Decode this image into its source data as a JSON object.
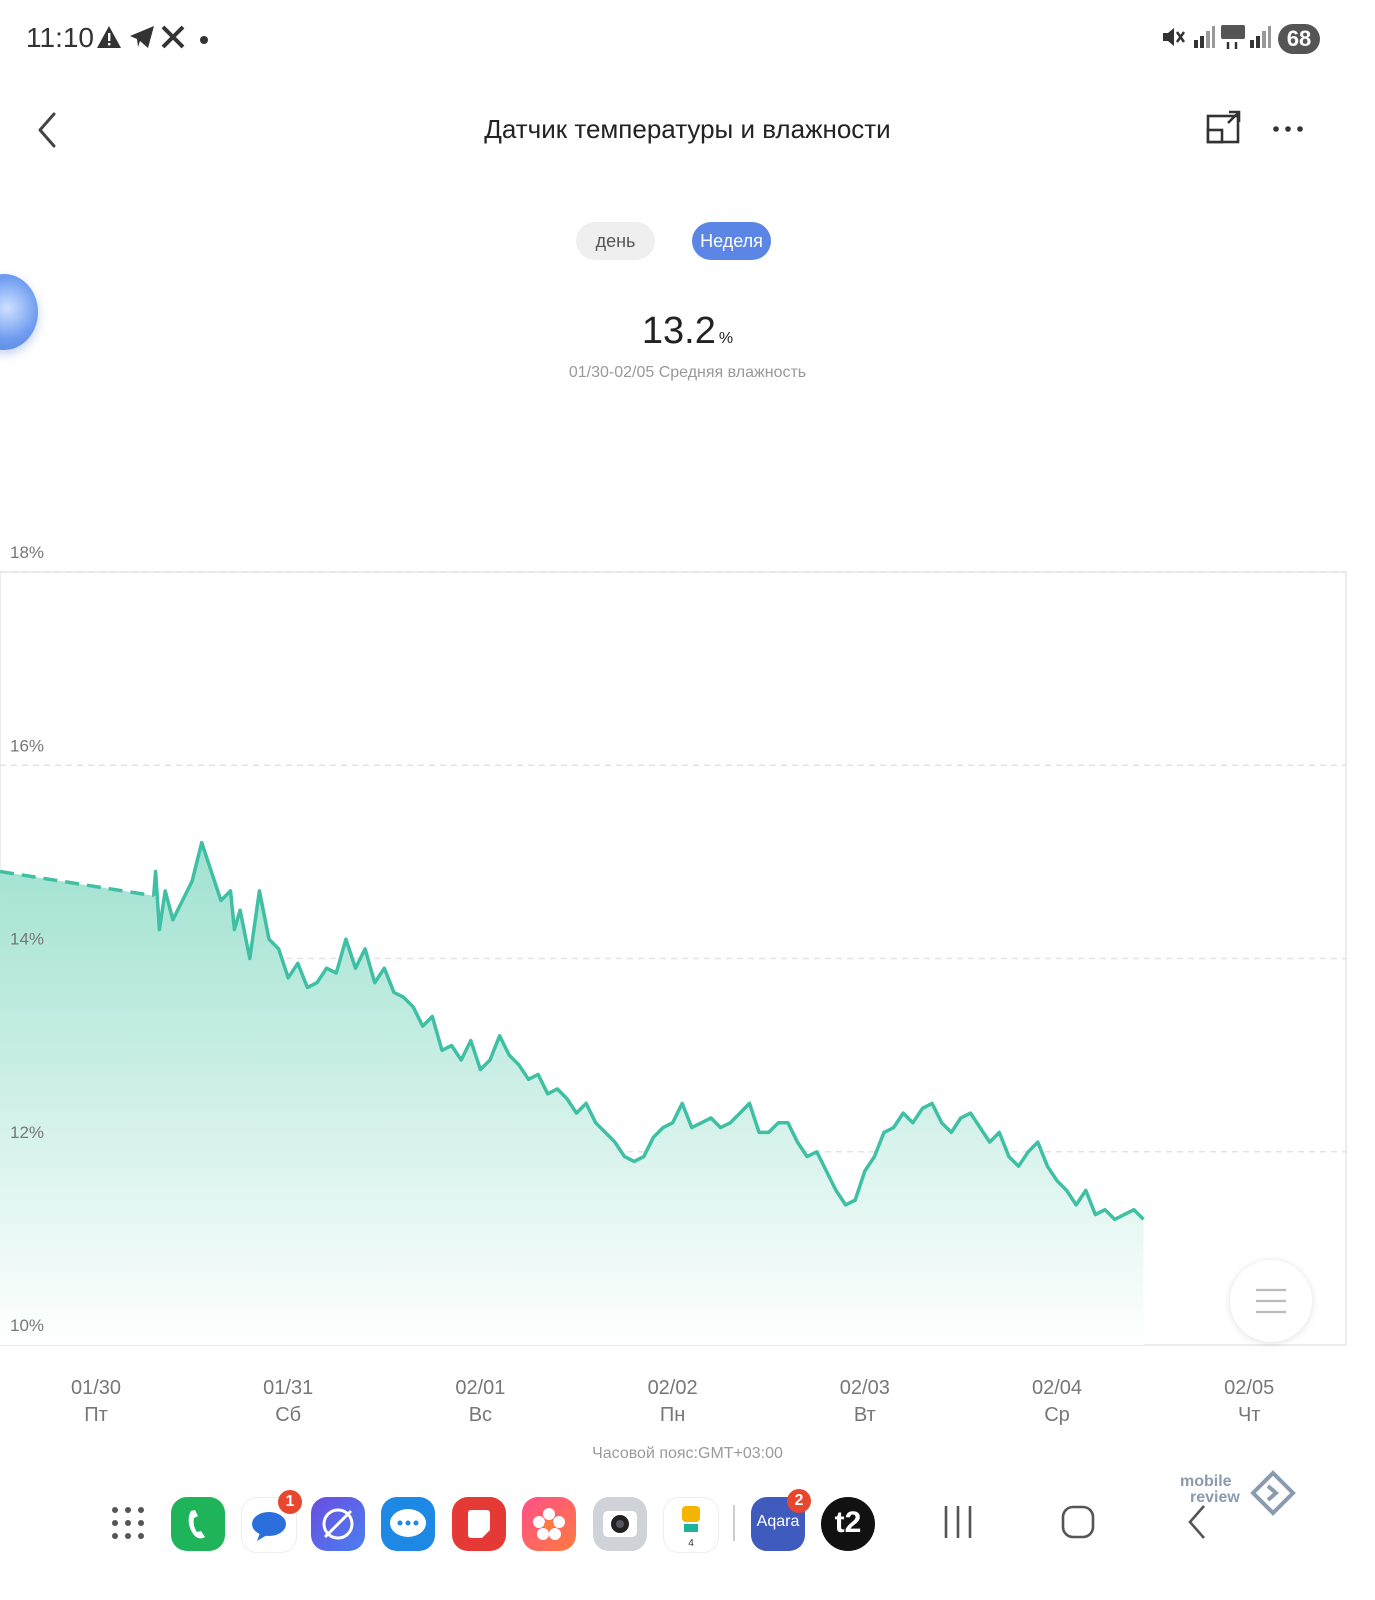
{
  "status_bar": {
    "time": "11:10",
    "battery": "68"
  },
  "header": {
    "title": "Датчик температуры и влажности"
  },
  "tabs": [
    {
      "label": "день",
      "selected": false
    },
    {
      "label": "Неделя",
      "selected": true
    }
  ],
  "summary": {
    "value": "13.2",
    "unit": "%",
    "caption": "01/30-02/05 Средняя влажность"
  },
  "chart_data": {
    "type": "area",
    "ylim": [
      10,
      18
    ],
    "y_ticks": [
      "10%",
      "12%",
      "14%",
      "16%",
      "18%"
    ],
    "y_tick_values": [
      10,
      12,
      14,
      16,
      18
    ],
    "x_ticks": [
      {
        "date": "01/30",
        "day": "Пт"
      },
      {
        "date": "01/31",
        "day": "Сб"
      },
      {
        "date": "02/01",
        "day": "Вс"
      },
      {
        "date": "02/02",
        "day": "Пн"
      },
      {
        "date": "02/03",
        "day": "Вт"
      },
      {
        "date": "02/04",
        "day": "Ср"
      },
      {
        "date": "02/05",
        "day": "Чт"
      }
    ],
    "grid": true,
    "line_color": "#3fbfa3",
    "fill_color": "#a6e3d3",
    "series": [
      {
        "x": [
          -0.5,
          0.3,
          0.31,
          0.33,
          0.36,
          0.4,
          0.45,
          0.5,
          0.55,
          0.6,
          0.65,
          0.7,
          0.72,
          0.75,
          0.78,
          0.8,
          0.85,
          0.9,
          0.95,
          1.0,
          1.05,
          1.1,
          1.15,
          1.2,
          1.25,
          1.3,
          1.35,
          1.4,
          1.45,
          1.5,
          1.55,
          1.6,
          1.65,
          1.7,
          1.75,
          1.8,
          1.85,
          1.9,
          1.95,
          2.0,
          2.05,
          2.1,
          2.15,
          2.2,
          2.25,
          2.3,
          2.35,
          2.4,
          2.45,
          2.5,
          2.55,
          2.6,
          2.65,
          2.7,
          2.75,
          2.8,
          2.85,
          2.9,
          2.95,
          3.0,
          3.05,
          3.1,
          3.15,
          3.2,
          3.25,
          3.3,
          3.35,
          3.4,
          3.45,
          3.5,
          3.55,
          3.6,
          3.65,
          3.7,
          3.75,
          3.8,
          3.85,
          3.9,
          3.95,
          4.0,
          4.05,
          4.1,
          4.15,
          4.2,
          4.25,
          4.3,
          4.35,
          4.4,
          4.45,
          4.5,
          4.55,
          4.6,
          4.65,
          4.7,
          4.75,
          4.8,
          4.85,
          4.9,
          4.95,
          5.0,
          5.05,
          5.1,
          5.15,
          5.2,
          5.25,
          5.3,
          5.35,
          5.4,
          5.45
        ],
        "y": [
          14.9,
          14.65,
          14.9,
          14.3,
          14.7,
          14.4,
          14.6,
          14.8,
          15.2,
          14.9,
          14.6,
          14.7,
          14.3,
          14.5,
          14.2,
          14.0,
          14.7,
          14.2,
          14.1,
          13.8,
          13.95,
          13.7,
          13.75,
          13.9,
          13.85,
          14.2,
          13.9,
          14.1,
          13.75,
          13.9,
          13.65,
          13.6,
          13.5,
          13.3,
          13.4,
          13.05,
          13.1,
          12.95,
          13.15,
          12.85,
          12.95,
          13.2,
          13.0,
          12.9,
          12.75,
          12.8,
          12.6,
          12.65,
          12.55,
          12.4,
          12.5,
          12.3,
          12.2,
          12.1,
          11.95,
          11.9,
          11.95,
          12.15,
          12.25,
          12.3,
          12.5,
          12.25,
          12.3,
          12.35,
          12.25,
          12.3,
          12.4,
          12.5,
          12.2,
          12.2,
          12.3,
          12.3,
          12.1,
          11.95,
          12.0,
          11.8,
          11.6,
          11.45,
          11.5,
          11.8,
          11.95,
          12.2,
          12.25,
          12.4,
          12.3,
          12.45,
          12.5,
          12.3,
          12.2,
          12.35,
          12.4,
          12.25,
          12.1,
          12.2,
          11.95,
          11.85,
          12.0,
          12.1,
          11.85,
          11.7,
          11.6,
          11.45,
          11.6,
          11.35,
          11.4,
          11.3,
          11.35,
          11.4,
          11.3
        ]
      }
    ]
  },
  "timezone": "Часовой пояс:GMT+03:00",
  "dock": {
    "apps": [
      {
        "name": "phone"
      },
      {
        "name": "messages",
        "badge": "1"
      },
      {
        "name": "browser"
      },
      {
        "name": "chat"
      },
      {
        "name": "notes"
      },
      {
        "name": "gallery"
      },
      {
        "name": "camera"
      },
      {
        "name": "calendar"
      },
      {
        "name": "aqara",
        "label": "Aqara",
        "badge": "2"
      },
      {
        "name": "t2",
        "label": "t2"
      }
    ]
  },
  "watermark": {
    "line1": "mobile",
    "line2": "review"
  }
}
